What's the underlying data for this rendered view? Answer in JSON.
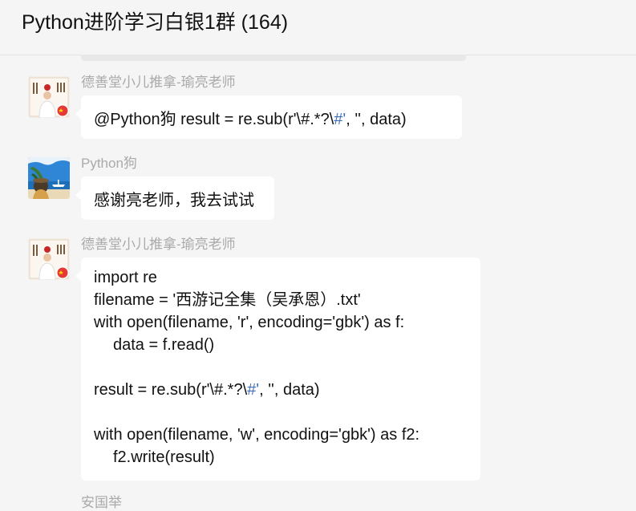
{
  "header": {
    "title": "Python进阶学习白银1群 (164)"
  },
  "messages": [
    {
      "sender": "德善堂小儿推拿-瑜亮老师",
      "avatar_icon": "teacher-avatar",
      "prefix": "@Python狗 result = re.sub(r'\\#.*?\\",
      "highlight": "#'",
      "suffix": ", '', data)"
    },
    {
      "sender": "Python狗",
      "avatar_icon": "beach-scene-avatar",
      "text": "感谢亮老师，我去试试"
    },
    {
      "sender": "德善堂小儿推拿-瑜亮老师",
      "avatar_icon": "teacher-avatar",
      "code": {
        "l1": "import re",
        "l2": "filename = '西游记全集（吴承恩）.txt'",
        "l3": "with open(filename, 'r', encoding='gbk') as f:",
        "l4": "data = f.read()",
        "l6_prefix": "result = re.sub(r'\\#.*?\\",
        "l6_highlight": "#'",
        "l6_suffix": ", '', data)",
        "l8": "with open(filename, 'w', encoding='gbk') as f2:",
        "l9": "f2.write(result)"
      }
    }
  ],
  "next_sender_partial": "安国举",
  "colors": {
    "background": "#f5f5f5",
    "bubble": "#ffffff",
    "sender": "#aaaaaa",
    "highlight": "#3f6fb5"
  }
}
